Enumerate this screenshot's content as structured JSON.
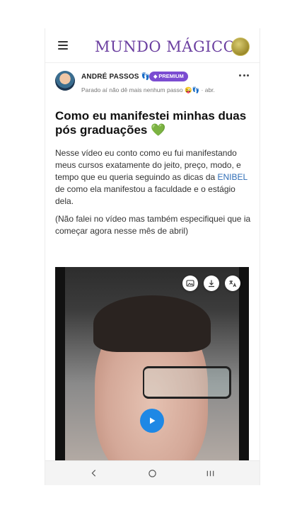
{
  "header": {
    "brand": "MUNDO MÁGICO",
    "menu_icon": "hamburger-icon",
    "profile_icon": "profile-avatar"
  },
  "post": {
    "author": "ANDRÉ PASSOS 👣",
    "badge": "PREMIUM",
    "badge_color": "#7b4cd1",
    "status_line": "Parado aí não dê mais nenhum passo 😜👣 · abr.",
    "title": "Como eu manifestei minhas duas pós graduações 💚",
    "body_1_part_1": "Nesse vídeo eu conto como eu fui manifestando meus cursos exatamente do jeito, preço, modo, e tempo que eu queria seguindo as dicas da",
    "mention": "ENIBEL",
    "body_1_part_2": "de como ela manifestou a faculdade e o estágio dela.",
    "body_2": "(Não falei no vídeo mas também especifiquei que ia começar agora nesse mês de abril)"
  },
  "video": {
    "buttons": [
      "image-icon",
      "download-icon",
      "translate-icon"
    ],
    "play_icon": "play-icon",
    "accent": "#1e88e5"
  },
  "system_nav": {
    "buttons": [
      "back-icon",
      "home-icon",
      "recents-icon"
    ]
  }
}
